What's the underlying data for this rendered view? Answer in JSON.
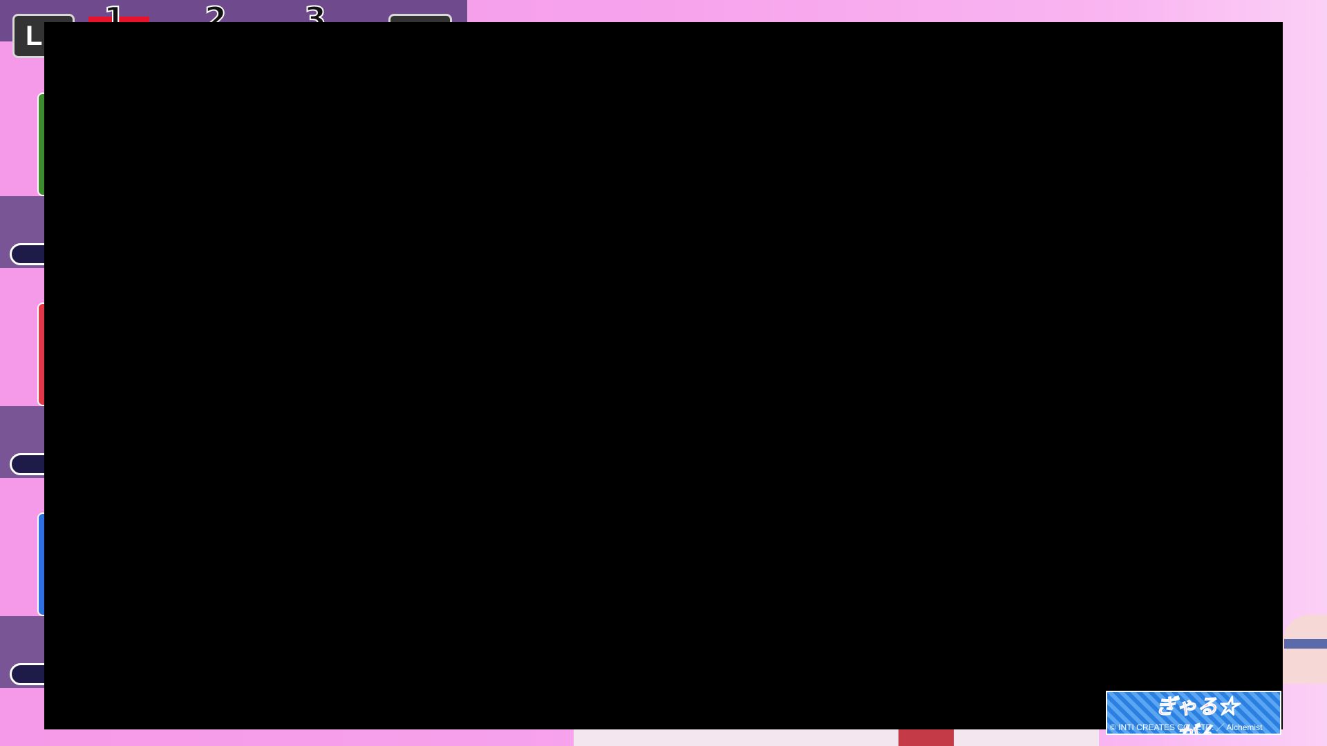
{
  "hud": {
    "left_button": "L",
    "pages": [
      "1",
      "2",
      "3"
    ],
    "active_page": "1"
  },
  "logo": {
    "title_art": "ぎゃる☆がん",
    "copyright": "© INTI CREATES CO., LTD. ／ Alchemist"
  },
  "cards": [
    {
      "color": "#3e8a2e"
    },
    {
      "color": "#e0384a"
    },
    {
      "color": "#2f6fe0"
    }
  ]
}
